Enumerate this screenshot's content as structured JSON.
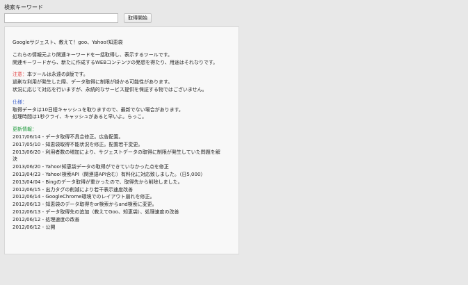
{
  "search": {
    "label": "検索キーワード",
    "value": "",
    "placeholder": "",
    "button_label": "取得開始"
  },
  "info": {
    "title": "Googleサジェスト、教えて！goo、Yahoo!知恵袋",
    "intro": [
      "これらの情報元より関連キーワードを一括取得し、表示するツールです。",
      "関連キーワードから、新たに作成するWEBコンテンツの発想を得たり、用途はそれなりです。"
    ],
    "notice": {
      "label": "注意：",
      "first_line": "本ツールは永遠のβ版です。",
      "lines": [
        "過剰な利用が発生した際、データ取得に制限が掛かる可能性があります。",
        "状況に応じて対応を行いますが、永続的なサービス提供を保証する物ではございません。"
      ]
    },
    "spec": {
      "label": "仕様：",
      "lines": [
        "取得データは10日程キャッシュを取りますので、最新でない場合があります。",
        "処理時間は1秒クライ、キャッシュがあると早いよ。らっこ。"
      ]
    },
    "history": {
      "label": "更新情報：",
      "items": [
        "2017/06/14 - データ取得不具合修正。広告配置。",
        "2017/05/10 - 知恵袋取得不能状況を修正。配置若干変更。",
        "2013/06/20 - 利用者数の増加により、サジェストデータの取得に制限が発生していた問題を解",
        "決",
        "2013/06/20 - Yahoo!知恵袋データの取得ができていなかった点を修正",
        "2013/04/23 - Yahoo!検索API（関連語API含む）有料化に対応致しました。（日5,000）",
        "2013/04/04 - Bingのデータ取得が重かったので、取得先から削除しました。",
        "2012/06/15 - 出力タグの削減により若干表示速度改善",
        "2012/06/14 - GoogleChrome環境でのレイアウト崩れを修正。",
        "2012/06/13 - 知恵袋のデータ取得をor検索からand検索に変更。",
        "2012/06/13 - データ取得先の追加（教えてGoo、知恵袋）、処理速度の改善",
        "2012/06/12 - 処理速度の改善",
        "2012/06/12 - 公開"
      ]
    }
  }
}
